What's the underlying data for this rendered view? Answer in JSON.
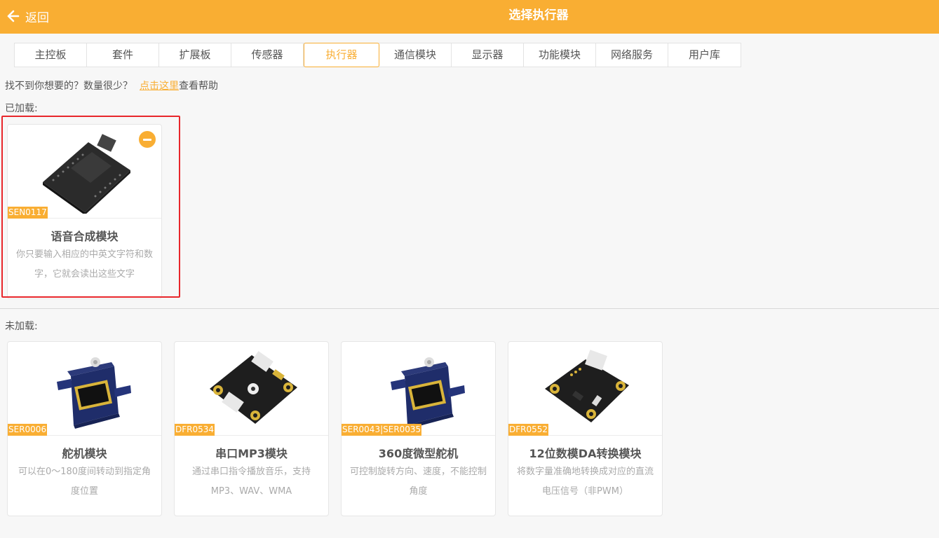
{
  "header": {
    "back_label": "返回",
    "title": "选择执行器",
    "background": "#f9ae33"
  },
  "tabs": [
    {
      "label": "主控板"
    },
    {
      "label": "套件"
    },
    {
      "label": "扩展板"
    },
    {
      "label": "传感器"
    },
    {
      "label": "执行器",
      "active": true
    },
    {
      "label": "通信模块"
    },
    {
      "label": "显示器"
    },
    {
      "label": "功能模块"
    },
    {
      "label": "网络服务"
    },
    {
      "label": "用户库"
    }
  ],
  "help": {
    "prefix": "找不到你想要的？数量很少？",
    "link": "点击这里",
    "suffix": "查看帮助"
  },
  "loaded": {
    "label": "已加载:",
    "items": [
      {
        "sku": "SEN0117",
        "name": "语音合成模块",
        "desc": "你只要输入相应的中英文字符和数字，它就会读出这些文字",
        "icon": "speech-synth-board-icon"
      }
    ]
  },
  "unloaded": {
    "label": "未加载:",
    "items": [
      {
        "sku": "SER0006",
        "name": "舵机模块",
        "desc": "可以在0～180度间转动到指定角度位置",
        "icon": "servo-icon"
      },
      {
        "sku": "DFR0534",
        "name": "串口MP3模块",
        "desc": "通过串口指令播放音乐，支持MP3、WAV、WMA",
        "icon": "mp3-module-icon"
      },
      {
        "sku": "SER0043|SER0035",
        "name": "360度微型舵机",
        "desc": "可控制旋转方向、速度，不能控制角度",
        "icon": "servo-icon"
      },
      {
        "sku": "DFR0552",
        "name": "12位数模DA转换模块",
        "desc": "将数字量准确地转换成对应的直流电压信号（非PWM）",
        "icon": "dac-module-icon"
      }
    ]
  }
}
